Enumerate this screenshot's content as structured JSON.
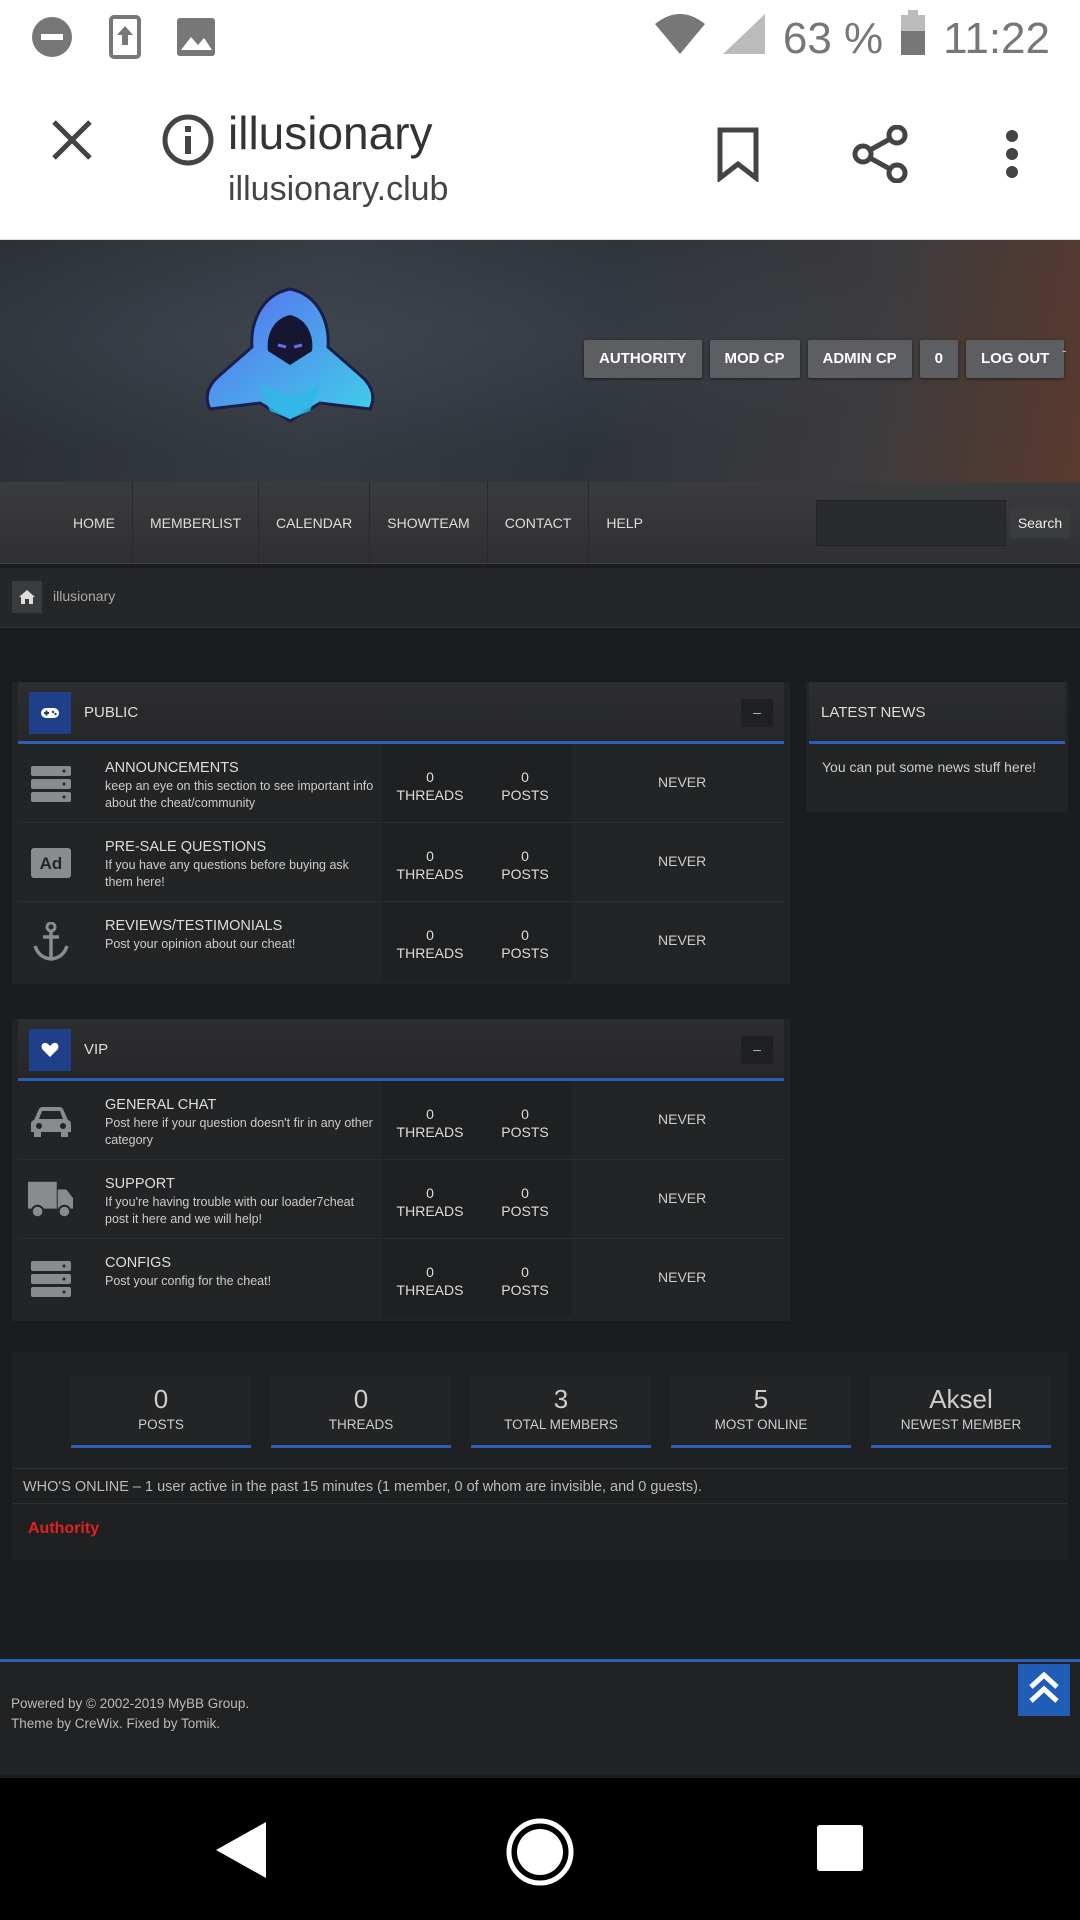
{
  "status_bar": {
    "battery": "63 %",
    "time": "11:22"
  },
  "browser": {
    "title": "illusionary",
    "url": "illusionary.club"
  },
  "header": {
    "buttons": [
      "AUTHORITY",
      "MOD CP",
      "ADMIN CP",
      "0",
      "LOG OUT"
    ],
    "trailing_mark": "-"
  },
  "nav": {
    "items": [
      "HOME",
      "MEMBERLIST",
      "CALENDAR",
      "SHOWTEAM",
      "CONTACT",
      "HELP"
    ],
    "search_label": "Search"
  },
  "breadcrumb": {
    "current": "illusionary"
  },
  "categories": [
    {
      "name": "PUBLIC",
      "collapse": "–",
      "forums": [
        {
          "name": "ANNOUNCEMENTS",
          "desc": "keep an eye on this section to see important info about the cheat/community",
          "threads": "0",
          "threads_label": "THREADS",
          "posts": "0",
          "posts_label": "POSTS",
          "lastpost": "NEVER"
        },
        {
          "name": "PRE-SALE QUESTIONS",
          "desc": "If you have any questions before buying ask them here!",
          "threads": "0",
          "threads_label": "THREADS",
          "posts": "0",
          "posts_label": "POSTS",
          "lastpost": "NEVER"
        },
        {
          "name": "REVIEWS/TESTIMONIALS",
          "desc": "Post your opinion about our cheat!",
          "threads": "0",
          "threads_label": "THREADS",
          "posts": "0",
          "posts_label": "POSTS",
          "lastpost": "NEVER"
        }
      ]
    },
    {
      "name": "VIP",
      "collapse": "–",
      "forums": [
        {
          "name": "GENERAL CHAT",
          "desc": "Post here if your question doesn't fir in any other category",
          "threads": "0",
          "threads_label": "THREADS",
          "posts": "0",
          "posts_label": "POSTS",
          "lastpost": "NEVER"
        },
        {
          "name": "SUPPORT",
          "desc": "If you're having trouble with our loader7cheat post it here and we will help!",
          "threads": "0",
          "threads_label": "THREADS",
          "posts": "0",
          "posts_label": "POSTS",
          "lastpost": "NEVER"
        },
        {
          "name": "CONFIGS",
          "desc": "Post your config for the cheat!",
          "threads": "0",
          "threads_label": "THREADS",
          "posts": "0",
          "posts_label": "POSTS",
          "lastpost": "NEVER"
        }
      ]
    }
  ],
  "news": {
    "title": "LATEST NEWS",
    "text": "You can put some news stuff here!"
  },
  "stats": [
    {
      "value": "0",
      "label": "POSTS"
    },
    {
      "value": "0",
      "label": "THREADS"
    },
    {
      "value": "3",
      "label": "TOTAL MEMBERS"
    },
    {
      "value": "5",
      "label": "MOST ONLINE"
    },
    {
      "value": "Aksel",
      "label": "NEWEST MEMBER"
    }
  ],
  "online": {
    "text": "WHO'S ONLINE – 1 user active in the past 15 minutes (1 member, 0 of whom are invisible, and 0 guests).",
    "user": "Authority"
  },
  "footer": {
    "line1": "Powered by © 2002-2019 MyBB Group.",
    "line2": "Theme by CreWix. Fixed by Tomik."
  },
  "colors": {
    "accent": "#2a5fb8",
    "online_user": "#e12020",
    "category_icon_bg": "#1f3f8a"
  }
}
